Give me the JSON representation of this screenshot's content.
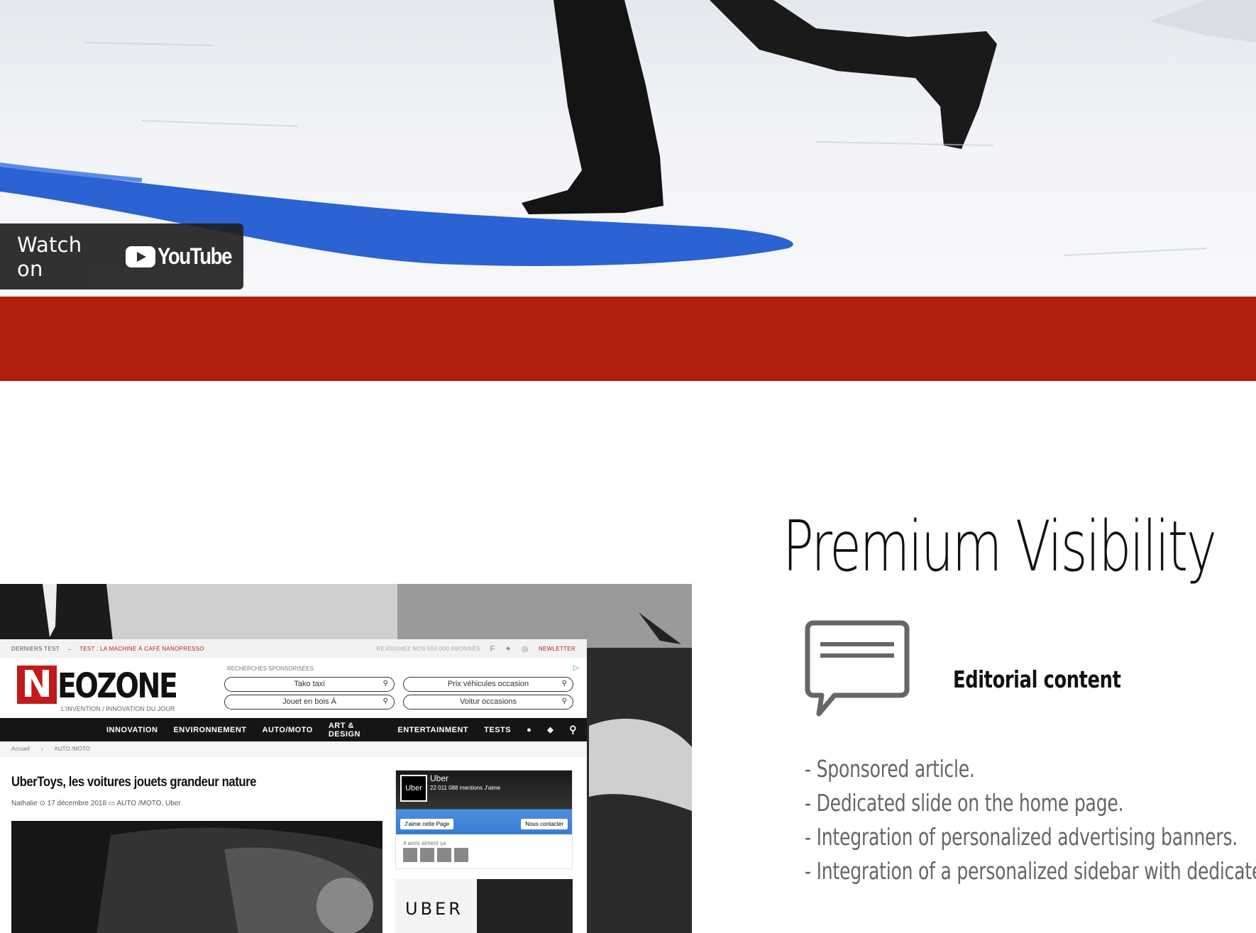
{
  "video": {
    "watch_label": "Watch on",
    "brand_label": "YouTube",
    "play_icon": "youtube-play-icon"
  },
  "colors": {
    "accent_band": "#b11f0a",
    "heading": "#111111",
    "bullet_text": "#666666"
  },
  "mock_site": {
    "topbar": {
      "latest_label": "DERNIERS TEST",
      "latest_item": "TEST : LA MACHINE À CAFÉ NANOPRESSO",
      "join_text": "REJOIGNEZ NOS 550.000 ABONNÉS",
      "newsletter": "NEWLETTER"
    },
    "logo_letter": "N",
    "logo_rest": "EOZONE",
    "logo_tagline": "L'INVENTION / INNOVATION DU JOUR",
    "sponsored_label": "RECHERCHES SPONSORISÉES",
    "search_pills": [
      "Tako taxi",
      "Prix véhicules occasion",
      "Jouet en bois À",
      "Voitur occasions"
    ],
    "nav": [
      "INNOVATION",
      "ENVIRONNEMENT",
      "AUTO/MOTO",
      "ART & DESIGN",
      "ENTERTAINMENT",
      "TESTS"
    ],
    "breadcrumb": [
      "Accueil",
      "›",
      "AUTO /MOTO"
    ],
    "article_title": "UberToys, les voitures jouets grandeur nature",
    "article_meta": "Nathalie   ⊙ 17 décembre 2018   ▭ AUTO /MOTO, Uber",
    "fb": {
      "page_name": "Uber",
      "likes": "22 011 088 mentions J'aime",
      "avatar_text": "Uber",
      "like_btn": "J'aime cette Page",
      "contact_btn": "Nous contacter",
      "friends": "4 amis aiment ça"
    },
    "ad_text": "UBER"
  },
  "section": {
    "title": "Premium Visibility",
    "feature_label": "Editorial content",
    "bullets": [
      "- Sponsored article.",
      "- Dedicated slide on the home page.",
      "- Integration of personalized advertising banners.",
      "- Integration of a personalized sidebar with dedicated"
    ]
  }
}
